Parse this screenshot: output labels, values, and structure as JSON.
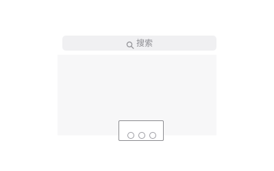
{
  "search": {
    "placeholder": "搜索",
    "icon": "search-icon"
  },
  "more_card": {
    "icon": "more-dots-icon"
  },
  "colors": {
    "search_bg": "#f0f0f2",
    "panel_bg": "#f7f7f8",
    "placeholder_text": "#8e8e93",
    "card_border": "#8a8a8e"
  }
}
